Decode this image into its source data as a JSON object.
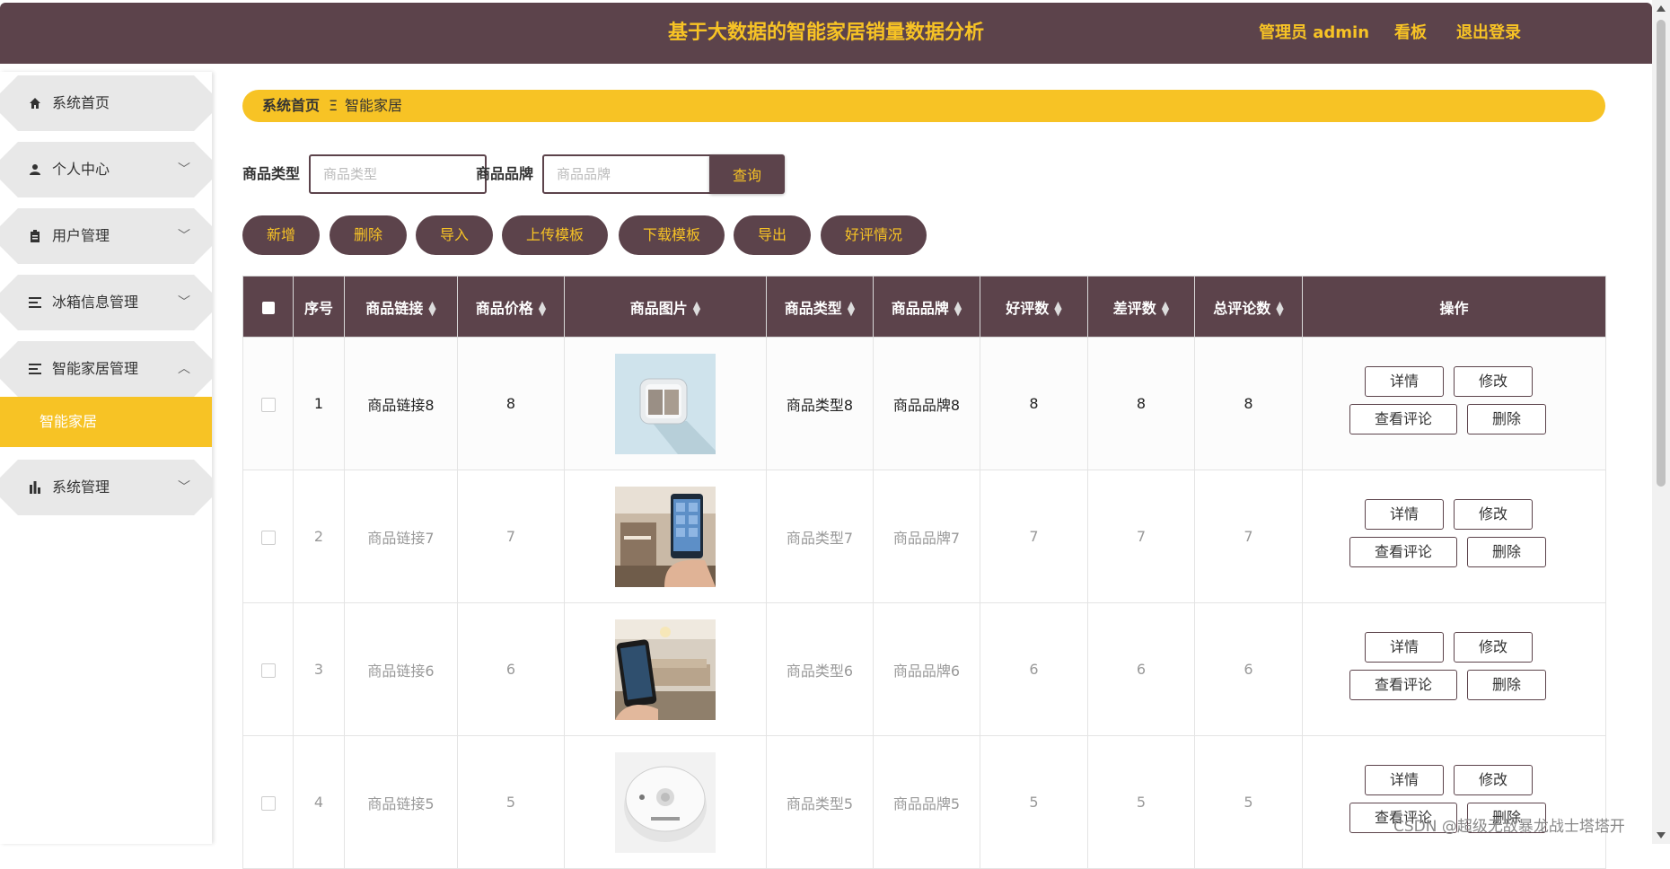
{
  "header": {
    "title": "基于大数据的智能家居销量数据分析",
    "admin": "管理员 admin",
    "board": "看板",
    "logout": "退出登录"
  },
  "sidebar": {
    "items": [
      {
        "label": "系统首页",
        "icon": "home-icon"
      },
      {
        "label": "个人中心",
        "icon": "user-icon"
      },
      {
        "label": "用户管理",
        "icon": "clipboard-icon"
      },
      {
        "label": "冰箱信息管理",
        "icon": "list-icon"
      },
      {
        "label": "智能家居管理",
        "icon": "list-icon"
      },
      {
        "label": "系统管理",
        "icon": "bar-chart-icon"
      }
    ],
    "sub_active": "智能家居"
  },
  "breadcrumb": {
    "home": "系统首页",
    "separator": "Ξ",
    "current": "智能家居"
  },
  "search": {
    "type_label": "商品类型",
    "type_placeholder": "商品类型",
    "brand_label": "商品品牌",
    "brand_placeholder": "商品品牌",
    "query": "查询"
  },
  "actions": {
    "add": "新增",
    "delete": "删除",
    "import": "导入",
    "upload_template": "上传模板",
    "download_template": "下载模板",
    "export": "导出",
    "good_reviews": "好评情况"
  },
  "table": {
    "headers": [
      "序号",
      "商品链接",
      "商品价格",
      "商品图片",
      "商品类型",
      "商品品牌",
      "好评数",
      "差评数",
      "总评论数",
      "操作"
    ],
    "rows": [
      {
        "no": "1",
        "link": "商品链接8",
        "price": "8",
        "type": "商品类型8",
        "brand": "商品品牌8",
        "good": "8",
        "bad": "8",
        "total": "8"
      },
      {
        "no": "2",
        "link": "商品链接7",
        "price": "7",
        "type": "商品类型7",
        "brand": "商品品牌7",
        "good": "7",
        "bad": "7",
        "total": "7"
      },
      {
        "no": "3",
        "link": "商品链接6",
        "price": "6",
        "type": "商品类型6",
        "brand": "商品品牌6",
        "good": "6",
        "bad": "6",
        "total": "6"
      },
      {
        "no": "4",
        "link": "商品链接5",
        "price": "5",
        "type": "商品类型5",
        "brand": "商品品牌5",
        "good": "5",
        "bad": "5",
        "total": "5"
      }
    ],
    "ops": {
      "detail": "详情",
      "edit": "修改",
      "view_comments": "查看评论",
      "delete": "删除"
    }
  },
  "watermark": "CSDN @超级无敌暴龙战士塔塔开",
  "colors": {
    "primary": "#5c434b",
    "accent": "#f7c325"
  }
}
